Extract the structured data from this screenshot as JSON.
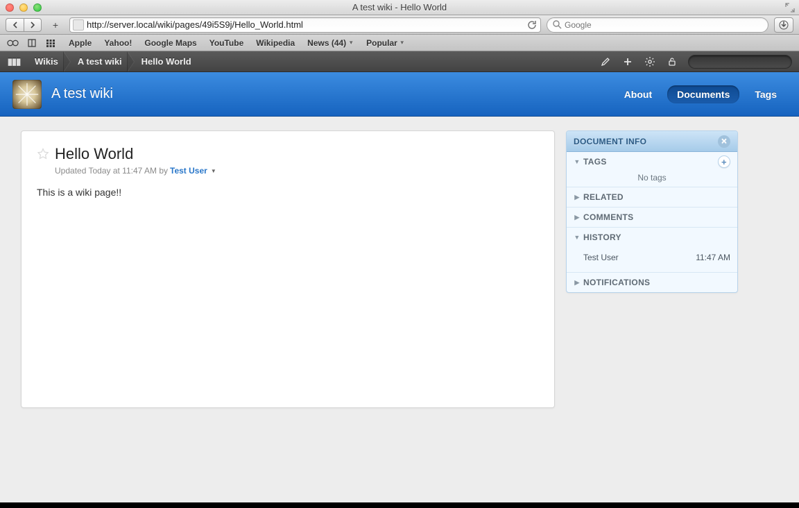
{
  "window": {
    "title": "A test wiki - Hello World"
  },
  "toolbar": {
    "url": "http://server.local/wiki/pages/49i5S9j/Hello_World.html",
    "search_placeholder": "Google"
  },
  "bookmarks": {
    "items": [
      "Apple",
      "Yahoo!",
      "Google Maps",
      "YouTube",
      "Wikipedia",
      "News (44)",
      "Popular"
    ]
  },
  "crumbs": {
    "items": [
      "Wikis",
      "A test wiki",
      "Hello World"
    ]
  },
  "blue": {
    "title": "A test wiki",
    "nav": {
      "about": "About",
      "documents": "Documents",
      "tags": "Tags"
    }
  },
  "doc": {
    "title": "Hello World",
    "meta_prefix": "Updated Today at 11:47 AM by",
    "meta_user": "Test User",
    "body": "This is a wiki page!!"
  },
  "panel": {
    "title": "DOCUMENT INFO",
    "tags": {
      "label": "TAGS",
      "empty": "No tags"
    },
    "related": {
      "label": "RELATED"
    },
    "comments": {
      "label": "COMMENTS"
    },
    "history": {
      "label": "HISTORY",
      "entries": [
        {
          "user": "Test User",
          "time": "11:47 AM"
        }
      ]
    },
    "notifications": {
      "label": "NOTIFICATIONS"
    }
  }
}
